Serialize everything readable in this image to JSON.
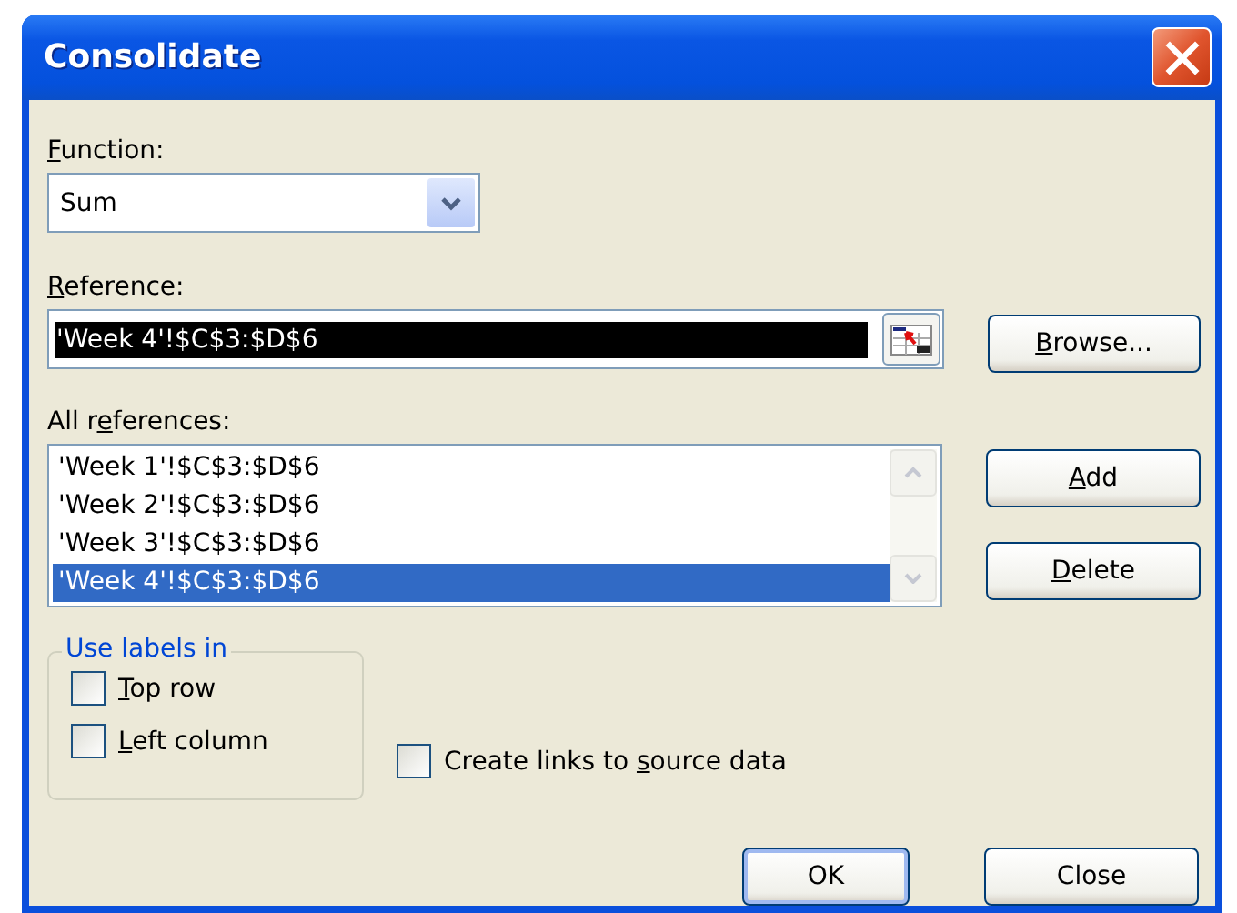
{
  "window": {
    "title": "Consolidate"
  },
  "function": {
    "label": {
      "key": "F",
      "after": "unction:"
    },
    "value": "Sum"
  },
  "reference": {
    "label": {
      "key": "R",
      "after": "eference:"
    },
    "value": "'Week 4'!$C$3:$D$6",
    "text_selected": true
  },
  "all_references": {
    "label": {
      "before": "All r",
      "key": "e",
      "after": "ferences:"
    },
    "items": [
      {
        "text": "'Week 1'!$C$3:$D$6",
        "selected": false
      },
      {
        "text": "'Week 2'!$C$3:$D$6",
        "selected": false
      },
      {
        "text": "'Week 3'!$C$3:$D$6",
        "selected": false
      },
      {
        "text": "'Week 4'!$C$3:$D$6",
        "selected": true
      }
    ]
  },
  "side_buttons": [
    {
      "label": {
        "key": "B",
        "after": "rowse..."
      }
    },
    {
      "label": {
        "key": "A",
        "after": "dd"
      }
    },
    {
      "label": {
        "key": "D",
        "after": "elete"
      }
    }
  ],
  "use_labels": {
    "legend": "Use labels in",
    "options": [
      {
        "label": {
          "key": "T",
          "after": "op row"
        },
        "checked": false
      },
      {
        "label": {
          "key": "L",
          "after": "eft column"
        },
        "checked": false
      }
    ]
  },
  "create_links": {
    "label": {
      "before": "Create links to ",
      "key": "s",
      "after": "ource data"
    },
    "checked": false
  },
  "buttons": [
    {
      "label": "OK",
      "default": true
    },
    {
      "label": "Close",
      "default": false
    }
  ]
}
